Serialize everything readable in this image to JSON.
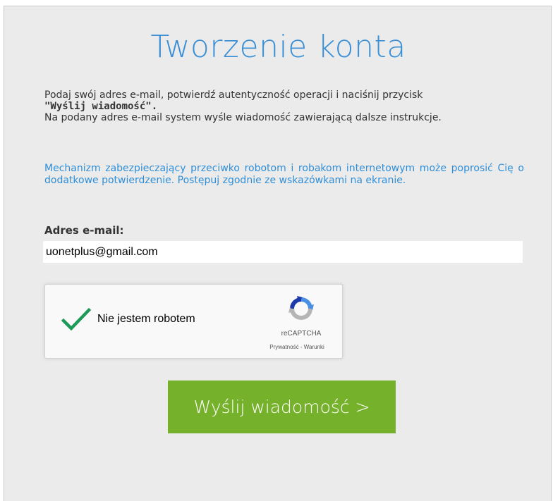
{
  "page": {
    "title": "Tworzenie konta"
  },
  "instructions": {
    "line1": "Podaj swój adres e-mail, potwierdź autentyczność operacji i naciśnij przycisk",
    "button_ref": "\"Wyślij wiadomość\".",
    "line2": "Na podany adres e-mail system wyśle wiadomość zawierającą dalsze instrukcje."
  },
  "notice": {
    "text": "Mechanizm zabezpieczający przeciwko robotom i robakom internetowym może poprosić Cię o dodatkowe potwierdzenie. Postępuj zgodnie ze wskazówkami na ekranie."
  },
  "form": {
    "email_label": "Adres e-mail:",
    "email_value": "uonetplus@gmail.com"
  },
  "recaptcha": {
    "checked": true,
    "label": "Nie jestem robotem",
    "brand": "reCAPTCHA",
    "privacy_link": "Prywatność",
    "separator": " - ",
    "terms_link": "Warunki",
    "check_icon": "checkmark-icon",
    "logo_icon": "recaptcha-logo-icon"
  },
  "actions": {
    "submit_label": "Wyślij wiadomość >"
  },
  "colors": {
    "title": "#3a8fd6",
    "notice": "#2e8ed8",
    "button": "#76b12b",
    "checkmark": "#1e9a58",
    "panel": "#ebebeb"
  }
}
